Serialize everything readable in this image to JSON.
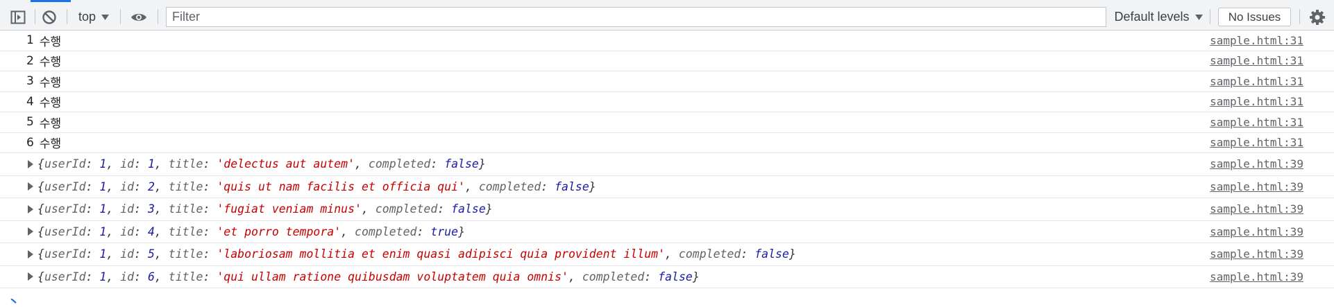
{
  "toolbar": {
    "context_label": "top",
    "filter_placeholder": "Filter",
    "levels_label": "Default levels",
    "issues_label": "No Issues",
    "icons": [
      "sidebar-toggle-icon",
      "clear-console-icon",
      "dropdown-arrow-icon",
      "eye-icon",
      "settings-gear-icon"
    ],
    "accent_color": "#1a73e8"
  },
  "logs": [
    {
      "num": "1",
      "text": "수행",
      "source": "sample.html:31"
    },
    {
      "num": "2",
      "text": "수행",
      "source": "sample.html:31"
    },
    {
      "num": "3",
      "text": "수행",
      "source": "sample.html:31"
    },
    {
      "num": "4",
      "text": "수행",
      "source": "sample.html:31"
    },
    {
      "num": "5",
      "text": "수행",
      "source": "sample.html:31"
    },
    {
      "num": "6",
      "text": "수행",
      "source": "sample.html:31"
    }
  ],
  "objects": [
    {
      "userId": "1",
      "id": "1",
      "title": "'delectus aut autem'",
      "completed": "false",
      "source": "sample.html:39"
    },
    {
      "userId": "1",
      "id": "2",
      "title": "'quis ut nam facilis et officia qui'",
      "completed": "false",
      "source": "sample.html:39"
    },
    {
      "userId": "1",
      "id": "3",
      "title": "'fugiat veniam minus'",
      "completed": "false",
      "source": "sample.html:39"
    },
    {
      "userId": "1",
      "id": "4",
      "title": "'et porro tempora'",
      "completed": "true",
      "source": "sample.html:39"
    },
    {
      "userId": "1",
      "id": "5",
      "title": "'laboriosam mollitia et enim quasi adipisci quia provident illum'",
      "completed": "false",
      "source": "sample.html:39"
    },
    {
      "userId": "1",
      "id": "6",
      "title": "'qui ullam ratione quibusdam voluptatem quia omnis'",
      "completed": "false",
      "source": "sample.html:39"
    }
  ],
  "object_keys": {
    "open": "{",
    "close": "}",
    "userId": "userId",
    "id": "id",
    "title": "title",
    "completed": "completed"
  }
}
